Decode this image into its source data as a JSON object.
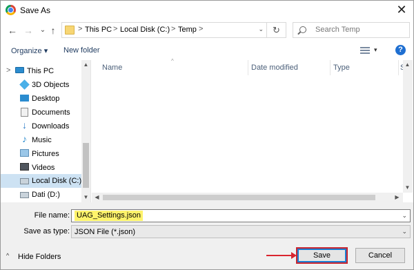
{
  "window": {
    "title": "Save As",
    "close_glyph": "✕",
    "app_icon": "chrome-icon"
  },
  "navigation": {
    "back_glyph": "←",
    "forward_glyph": "→",
    "recent_glyph": "⌄",
    "up_glyph": "↑",
    "breadcrumbs": [
      "This PC",
      "Local Disk (C:)",
      "Temp"
    ],
    "breadcrumb_separator": ">",
    "refresh_glyph": "↻",
    "search_placeholder": "Search Temp"
  },
  "toolbar": {
    "organize_label": "Organize ▾",
    "new_folder_label": "New folder",
    "view_drop_glyph": "▾",
    "help_glyph": "?"
  },
  "nav_pane": {
    "items": [
      {
        "label": "This PC",
        "icon": "pc-icon"
      },
      {
        "label": "3D Objects",
        "icon": "3d-objects-icon"
      },
      {
        "label": "Desktop",
        "icon": "desktop-icon"
      },
      {
        "label": "Documents",
        "icon": "documents-icon"
      },
      {
        "label": "Downloads",
        "icon": "downloads-icon"
      },
      {
        "label": "Music",
        "icon": "music-icon"
      },
      {
        "label": "Pictures",
        "icon": "pictures-icon"
      },
      {
        "label": "Videos",
        "icon": "videos-icon"
      },
      {
        "label": "Local Disk (C:)",
        "icon": "disk-icon",
        "selected": true
      },
      {
        "label": "Dati (D:)",
        "icon": "disk-icon"
      }
    ],
    "expand_glyph": ">",
    "dl_glyph": "↓",
    "music_glyph": "♪",
    "scroll_up": "▲",
    "scroll_down": "▼"
  },
  "file_list": {
    "columns": [
      "Name",
      "Date modified",
      "Type",
      "S"
    ],
    "sort_glyph": "^",
    "scroll_up": "▲",
    "scroll_down": "▼",
    "scroll_left": "◀",
    "scroll_right": "▶"
  },
  "form": {
    "file_name_label": "File name:",
    "file_name_value": "UAG_Settings.json",
    "save_as_type_label": "Save as type:",
    "save_as_type_value": "JSON File (*.json)",
    "dropdown_glyph": "⌄"
  },
  "footer": {
    "hide_folders_label": "Hide Folders",
    "hide_folders_glyph": "^",
    "save_label": "Save",
    "cancel_label": "Cancel"
  },
  "colors": {
    "highlight": "#fff36b",
    "annotation_red": "#d9242f",
    "selection": "#cde2f3"
  }
}
